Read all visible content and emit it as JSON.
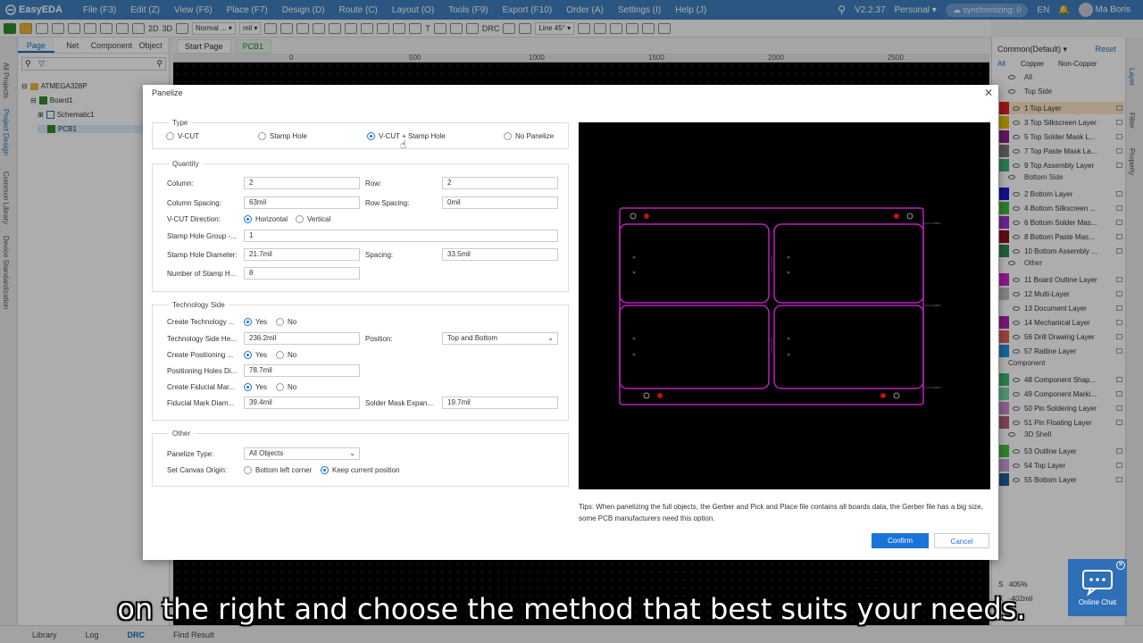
{
  "app": {
    "name": "EasyEDA",
    "version": "V2.2.37",
    "workspace": "Personal",
    "sync": "synchronizing: 0",
    "lang": "EN",
    "user": "Ma Boris"
  },
  "menu": [
    "File (F3)",
    "Edit (Z)",
    "View (F6)",
    "Place (F7)",
    "Design (D)",
    "Route (C)",
    "Layout (O)",
    "Tools (F9)",
    "Export (F10)",
    "Order (A)",
    "Settings (I)",
    "Help (J)"
  ],
  "toolbar": {
    "view2d": "2D",
    "view3d": "3D",
    "grid": "Normal ...",
    "unit": "mil",
    "route_angle": "Line 45°",
    "drc": "DRC"
  },
  "left_tabs": [
    "Page",
    "Net",
    "Component",
    "Object"
  ],
  "left_vtabs": [
    "All Projects",
    "Project Design",
    "Common Library",
    "Device Standardization"
  ],
  "tree": {
    "project": "ATMEGA328P",
    "board": "Board1",
    "schematic": "Schematic1",
    "pcb": "PCB1"
  },
  "doc_tabs": [
    "Start Page",
    "PCB1"
  ],
  "ruler": [
    "0",
    "500",
    "1000",
    "1500",
    "2000",
    "2500"
  ],
  "right_panel": {
    "preset": "Common(Default)",
    "reset": "Reset",
    "tabs": [
      "All",
      "Copper",
      "Non-Copper"
    ],
    "right_vtabs": [
      "Layer",
      "Filter",
      "Property"
    ],
    "groups": {
      "all": "All",
      "top": "Top Side",
      "bottom": "Bottom Side",
      "other": "Other",
      "component": "Component",
      "shell": "3D Shell"
    },
    "layers": [
      {
        "name": "1 Top Layer",
        "color": "#e02020"
      },
      {
        "name": "3 Top Silkscreen Layer",
        "color": "#e8c000"
      },
      {
        "name": "5 Top Solder Mask L...",
        "color": "#8a2090"
      },
      {
        "name": "7 Top Paste Mask La...",
        "color": "#7a7a7a"
      },
      {
        "name": "9 Top Assembly Layer",
        "color": "#3cb070"
      },
      {
        "name": "2 Bottom Layer",
        "color": "#1a1ad0"
      },
      {
        "name": "4 Bottom Silkscreen ...",
        "color": "#3cbc3c"
      },
      {
        "name": "6 Bottom Solder Mas...",
        "color": "#a030c8"
      },
      {
        "name": "8 Bottom Paste Mas...",
        "color": "#8a1020"
      },
      {
        "name": "10 Bottom Assembly ...",
        "color": "#2e8b57"
      },
      {
        "name": "11 Board Outline Layer",
        "color": "#d020d0"
      },
      {
        "name": "12 Multi-Layer",
        "color": "#c0c0c0"
      },
      {
        "name": "13 Document Layer",
        "color": "#ffffff"
      },
      {
        "name": "14 Mechanical Layer",
        "color": "#b020b0"
      },
      {
        "name": "56 Drill Drawing Layer",
        "color": "#e06060"
      },
      {
        "name": "57 Ratline Layer",
        "color": "#2090e0"
      },
      {
        "name": "48 Component Shap...",
        "color": "#3cb870"
      },
      {
        "name": "49 Component Marki...",
        "color": "#70d8a8"
      },
      {
        "name": "50 Pin Soldering Layer",
        "color": "#cc88cc"
      },
      {
        "name": "51 Pin Floating Layer",
        "color": "#b06080"
      },
      {
        "name": "53 Outline Layer",
        "color": "#40c040"
      },
      {
        "name": "54 Top Layer",
        "color": "#c8a0d8"
      },
      {
        "name": "55 Bottom Layer",
        "color": "#2060a0"
      }
    ]
  },
  "status": {
    "scale_label": "S",
    "scale": "405%",
    "x_label": "X",
    "x": "-402mil"
  },
  "bottom_tabs": [
    "Library",
    "Log",
    "DRC",
    "Find Result"
  ],
  "dialog": {
    "title": "Panelize",
    "type": {
      "legend": "Type",
      "options": [
        "V-CUT",
        "Stamp Hole",
        "V-CUT + Stamp Hole",
        "No Panelize"
      ]
    },
    "quantity": {
      "legend": "Quantity",
      "column_label": "Column:",
      "column": "2",
      "row_label": "Row:",
      "row": "2",
      "col_spacing_label": "Column Spacing:",
      "col_spacing": "63mil",
      "row_spacing_label": "Row Spacing:",
      "row_spacing": "0mil",
      "vcut_dir_label": "V-CUT Direction:",
      "vcut_opts": [
        "Horizontal",
        "Vertical"
      ],
      "stamp_group_label": "Stamp Hole Group -...",
      "stamp_group": "1",
      "stamp_dia_label": "Stamp Hole Diameter:",
      "stamp_dia": "21.7mil",
      "spacing_label": "Spacing:",
      "spacing": "33.5mil",
      "num_stamp_label": "Number of Stamp H...",
      "num_stamp": "8"
    },
    "tech": {
      "legend": "Technology Side",
      "create_tech_label": "Create Technology ...",
      "tech_height_label": "Technology Side He...",
      "tech_height": "236.2mil",
      "position_label": "Position:",
      "position": "Top and Bottom",
      "create_pos_label": "Create Positioning ...",
      "pos_dia_label": "Positioning Holes Di...",
      "pos_dia": "78.7mil",
      "create_fid_label": "Create Fiducial Mar...",
      "fid_dia_label": "Fiducial Mark Diam...",
      "fid_dia": "39.4mil",
      "solder_exp_label": "Solder Mask Expan...",
      "solder_exp": "19.7mil",
      "yes": "Yes",
      "no": "No"
    },
    "other": {
      "legend": "Other",
      "panel_type_label": "Panelize Type:",
      "panel_type": "All Objects",
      "origin_label": "Set Canvas Origin:",
      "origin_opts": [
        "Bottom left corner",
        "Keep current position"
      ]
    },
    "preview_labels": [
      "V-CUT",
      "V-CUT",
      "V-CUT"
    ],
    "tips": "Tips: When panelizing the full objects, the Gerber and Pick and Place file contains all boards data, the Gerber file has a big size, some PCB manufacturers need this option.",
    "confirm": "Confirm",
    "cancel": "Cancel"
  },
  "chat": "Online Chat",
  "caption": "on the right and choose the method that best suits your needs."
}
